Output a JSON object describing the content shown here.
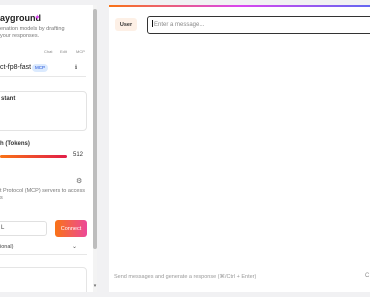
{
  "left": {
    "title": "ayground",
    "description_lines": [
      "enation models by drafting",
      "your responses."
    ],
    "capabilities": [
      "Chat",
      "Edit",
      "MCP"
    ],
    "model_name": "ct-fp8-fast",
    "model_badge": "MCP",
    "system_label": "stant",
    "length_label": "h (Tokens)",
    "max_tokens_value": "512",
    "max_tokens_fraction": 1.0,
    "mcp_desc_lines": [
      "t Protocol (MCP) servers to access",
      "s"
    ],
    "url_value": "L",
    "connect_label": "Connect",
    "optional_label": "ional)"
  },
  "main": {
    "role_label": "User",
    "message_placeholder": "Enter a message...",
    "footer_hint": "Send messages and generate a response (⌘/Ctrl + Enter)",
    "footer_right": "C"
  },
  "colors": {
    "accent_orange": "#f97316",
    "accent_pink": "#ec4899",
    "badge_blue": "#dbeafe"
  },
  "icons": [
    "sparkle-icon",
    "info-icon",
    "gear-icon",
    "chevron-down-icon"
  ]
}
